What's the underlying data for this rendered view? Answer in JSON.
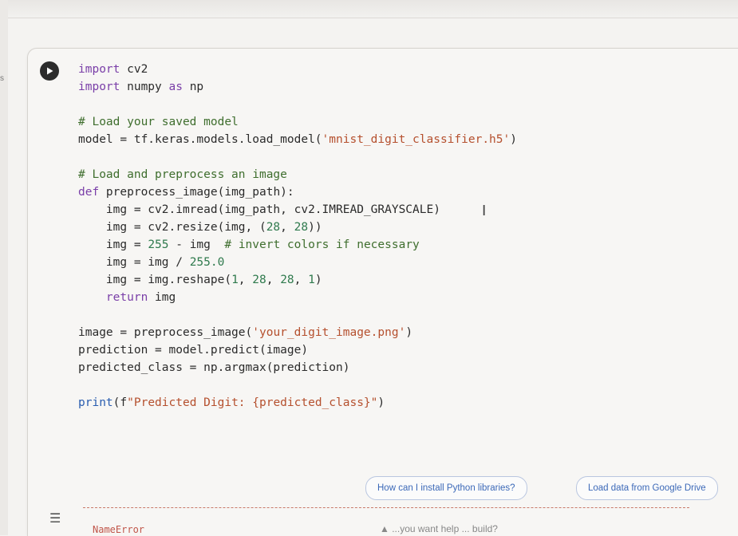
{
  "gutter": {
    "mark": "s"
  },
  "code_lines": [
    "import cv2",
    "import numpy as np",
    "",
    "# Load your saved model",
    "model = tf.keras.models.load_model('mnist_digit_classifier.h5')",
    "",
    "# Load and preprocess an image",
    "def preprocess_image(img_path):",
    "    img = cv2.imread(img_path, cv2.IMREAD_GRAYSCALE)",
    "    img = cv2.resize(img, (28, 28))",
    "    img = 255 - img  # invert colors if necessary",
    "    img = img / 255.0",
    "    img = img.reshape(1, 28, 28, 1)",
    "    return img",
    "",
    "image = preprocess_image('your_digit_image.png')",
    "prediction = model.predict(image)",
    "predicted_class = np.argmax(prediction)",
    "",
    "print(f\"Predicted Digit: {predicted_class}\")"
  ],
  "cursor_glyph": "I",
  "suggestions": [
    {
      "label": "How can I install Python libraries?"
    },
    {
      "label": "Load data from Google Drive"
    }
  ],
  "output": {
    "error_name": "NameError",
    "tip": "▲  ...you want help ... build?"
  },
  "icons": {
    "run": "play-icon",
    "output": "output-menu-icon"
  },
  "colors": {
    "chip_text": "#3c69b8",
    "error": "#c0564a",
    "keyword": "#7a3fa8"
  }
}
